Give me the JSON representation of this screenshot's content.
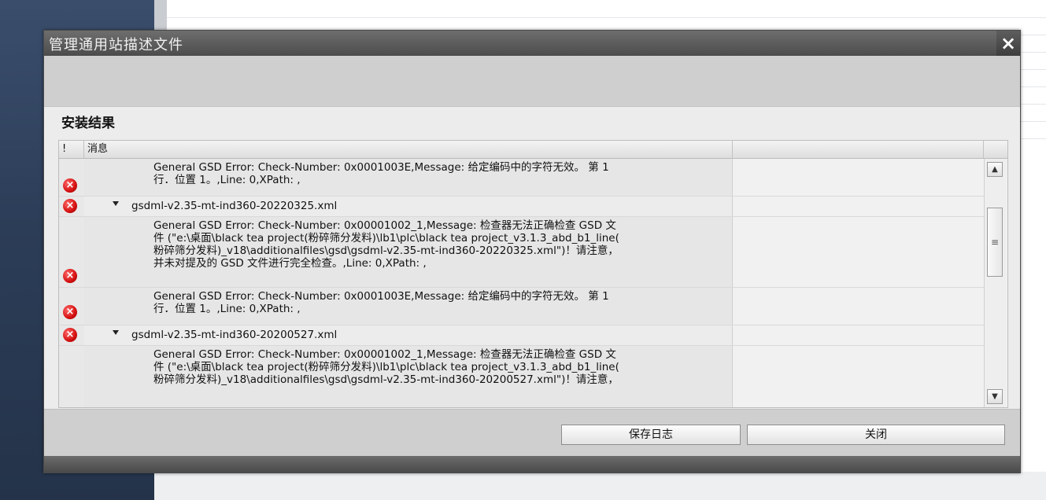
{
  "dialog": {
    "title": "管理通用站描述文件",
    "close_symbol": "×"
  },
  "section": {
    "title": "安装结果"
  },
  "table": {
    "col_flag": "!",
    "col_message": "消息"
  },
  "rows": [
    {
      "type": "message",
      "text": "General GSD Error: Check-Number: 0x0001003E,Message: 给定编码中的字符无效。 第 1\n行．位置 1。,Line: 0,XPath: ,"
    },
    {
      "type": "file",
      "text": "gsdml-v2.35-mt-ind360-20220325.xml"
    },
    {
      "type": "message",
      "text": "General GSD Error: Check-Number: 0x00001002_1,Message: 检查器无法正确检查 GSD 文\n件 (\"e:\\桌面\\black tea project(粉碎筛分发料)\\lb1\\plc\\black tea project_v3.1.3_abd_b1_line(\n粉碎筛分发料)_v18\\additionalfiles\\gsd\\gsdml-v2.35-mt-ind360-20220325.xml\")！请注意，\n并未对提及的 GSD 文件进行完全检查。,Line: 0,XPath: ,"
    },
    {
      "type": "message",
      "text": "General GSD Error: Check-Number: 0x0001003E,Message: 给定编码中的字符无效。 第 1\n行．位置 1。,Line: 0,XPath: ,"
    },
    {
      "type": "file",
      "text": "gsdml-v2.35-mt-ind360-20200527.xml"
    },
    {
      "type": "message",
      "text": "General GSD Error: Check-Number: 0x00001002_1,Message: 检查器无法正确检查 GSD 文\n件 (\"e:\\桌面\\black tea project(粉碎筛分发料)\\lb1\\plc\\black tea project_v3.1.3_abd_b1_line(\n粉碎筛分发料)_v18\\additionalfiles\\gsd\\gsdml-v2.35-mt-ind360-20200527.xml\")！请注意，"
    }
  ],
  "buttons": {
    "save_log": "保存日志",
    "close": "关闭"
  },
  "icons": {
    "error": "error-circle-icon",
    "expand": "expand-arrow-icon",
    "scroll_up": "scroll-up-icon",
    "scroll_down": "scroll-down-icon"
  },
  "colors": {
    "error": "#d40f0f",
    "titlebar": "#4c4c4c"
  }
}
